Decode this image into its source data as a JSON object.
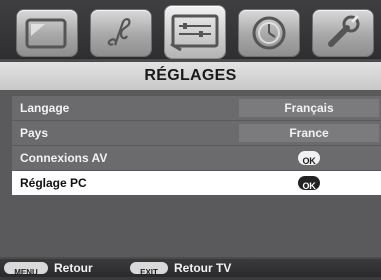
{
  "tabs": [
    {
      "name": "screen-icon"
    },
    {
      "name": "music-note-icon"
    },
    {
      "name": "settings-sliders-icon",
      "active": true
    },
    {
      "name": "clock-icon"
    },
    {
      "name": "wrench-icon"
    }
  ],
  "title": "RÉGLAGES",
  "menu": {
    "items": [
      {
        "label": "Langage",
        "value": "Français"
      },
      {
        "label": "Pays",
        "value": "France"
      },
      {
        "label": "Connexions AV",
        "action": "OK"
      },
      {
        "label": "Réglage PC",
        "action": "OK",
        "selected": true
      }
    ]
  },
  "footer": {
    "menu_key": "MENU",
    "menu_text": "Retour",
    "exit_key": "EXIT",
    "exit_text": "Retour TV"
  },
  "colors": {
    "selected_row": "#ffffff",
    "row": "#6b6b6d",
    "panel": "#5a5a5c"
  }
}
